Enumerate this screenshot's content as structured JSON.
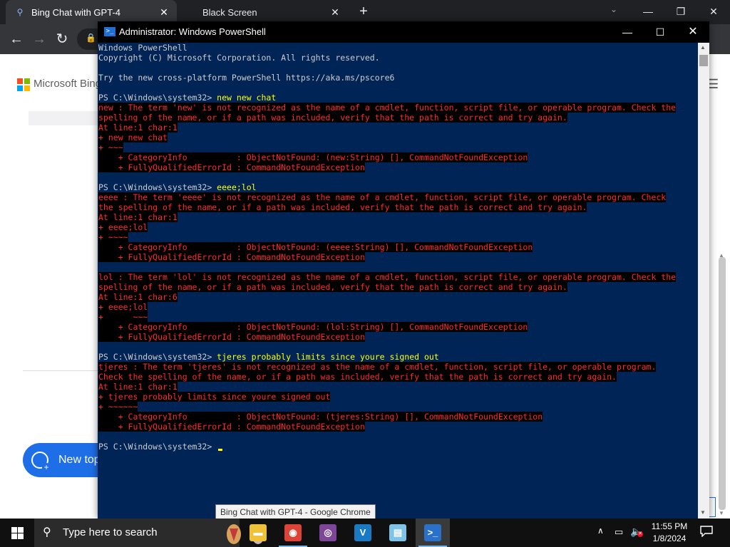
{
  "browser": {
    "tabs": [
      {
        "title": "Bing Chat with GPT-4",
        "active": true
      },
      {
        "title": "Black Screen",
        "active": false
      }
    ],
    "page": {
      "brand": "Microsoft Bing",
      "new_topic_label": "New top"
    },
    "tooltip": "Bing Chat with GPT-4 - Google Chrome"
  },
  "powershell": {
    "title": "Administrator: Windows PowerShell",
    "lines": [
      {
        "t": "Windows PowerShell",
        "k": "n"
      },
      {
        "t": "Copyright (C) Microsoft Corporation. All rights reserved.",
        "k": "n"
      },
      {
        "t": "",
        "k": "n"
      },
      {
        "t": "Try the new cross-platform PowerShell https://aka.ms/pscore6",
        "k": "n"
      },
      {
        "t": "",
        "k": "n"
      },
      {
        "t": "PS C:\\Windows\\system32> ",
        "c": "new new chat",
        "k": "p"
      },
      {
        "t": "new : The term 'new' is not recognized as the name of a cmdlet, function, script file, or operable program. Check the",
        "k": "e"
      },
      {
        "t": "spelling of the name, or if a path was included, verify that the path is correct and try again.",
        "k": "e"
      },
      {
        "t": "At line:1 char:1",
        "k": "e"
      },
      {
        "t": "+ new new chat",
        "k": "e"
      },
      {
        "t": "+ ~~~",
        "k": "e"
      },
      {
        "t": "    + CategoryInfo          : ObjectNotFound: (new:String) [], CommandNotFoundException",
        "k": "e"
      },
      {
        "t": "    + FullyQualifiedErrorId : CommandNotFoundException",
        "k": "e"
      },
      {
        "t": "",
        "k": "e"
      },
      {
        "t": "PS C:\\Windows\\system32> ",
        "c": "eeee;lol",
        "k": "p"
      },
      {
        "t": "eeee : The term 'eeee' is not recognized as the name of a cmdlet, function, script file, or operable program. Check",
        "k": "e"
      },
      {
        "t": "the spelling of the name, or if a path was included, verify that the path is correct and try again.",
        "k": "e"
      },
      {
        "t": "At line:1 char:1",
        "k": "e"
      },
      {
        "t": "+ eeee;lol",
        "k": "e"
      },
      {
        "t": "+ ~~~~",
        "k": "e"
      },
      {
        "t": "    + CategoryInfo          : ObjectNotFound: (eeee:String) [], CommandNotFoundException",
        "k": "e"
      },
      {
        "t": "    + FullyQualifiedErrorId : CommandNotFoundException",
        "k": "e"
      },
      {
        "t": "",
        "k": "e"
      },
      {
        "t": "lol : The term 'lol' is not recognized as the name of a cmdlet, function, script file, or operable program. Check the",
        "k": "e"
      },
      {
        "t": "spelling of the name, or if a path was included, verify that the path is correct and try again.",
        "k": "e"
      },
      {
        "t": "At line:1 char:6",
        "k": "e"
      },
      {
        "t": "+ eeee;lol",
        "k": "e"
      },
      {
        "t": "+      ~~~",
        "k": "e"
      },
      {
        "t": "    + CategoryInfo          : ObjectNotFound: (lol:String) [], CommandNotFoundException",
        "k": "e"
      },
      {
        "t": "    + FullyQualifiedErrorId : CommandNotFoundException",
        "k": "e"
      },
      {
        "t": "",
        "k": "n"
      },
      {
        "t": "PS C:\\Windows\\system32> ",
        "c": "tjeres probably limits since youre signed out",
        "k": "p"
      },
      {
        "t": "tjeres : The term 'tjeres' is not recognized as the name of a cmdlet, function, script file, or operable program.",
        "k": "e"
      },
      {
        "t": "Check the spelling of the name, or if a path was included, verify that the path is correct and try again.",
        "k": "e"
      },
      {
        "t": "At line:1 char:1",
        "k": "e"
      },
      {
        "t": "+ tjeres probably limits since youre signed out",
        "k": "e"
      },
      {
        "t": "+ ~~~~~~",
        "k": "e"
      },
      {
        "t": "    + CategoryInfo          : ObjectNotFound: (tjeres:String) [], CommandNotFoundException",
        "k": "e"
      },
      {
        "t": "    + FullyQualifiedErrorId : CommandNotFoundException",
        "k": "e"
      },
      {
        "t": "",
        "k": "e"
      },
      {
        "t": "PS C:\\Windows\\system32> ",
        "c": "",
        "k": "p",
        "cursor": true
      }
    ]
  },
  "taskbar": {
    "search_placeholder": "Type here to search",
    "apps": [
      {
        "name": "file-explorer",
        "glyph": "▬",
        "color": "#f0c23a",
        "active": false
      },
      {
        "name": "chrome",
        "glyph": "◉",
        "color": "#db4437",
        "active": true
      },
      {
        "name": "tor-browser",
        "glyph": "◎",
        "color": "#7d4698",
        "active": false
      },
      {
        "name": "visual-studio",
        "glyph": "V",
        "color": "#1a7bc4",
        "active": false
      },
      {
        "name": "notepad",
        "glyph": "▤",
        "color": "#7fc3e8",
        "active": false
      },
      {
        "name": "powershell",
        "glyph": ">_",
        "color": "#2a72c9",
        "active": true
      }
    ],
    "clock_time": "11:55 PM",
    "clock_date": "1/8/2024"
  },
  "colors": {
    "ps_bg": "#012456",
    "error_fg": "#ff2a2a",
    "command_fg": "#ffff00",
    "bing_blue": "#1e6ee8"
  }
}
